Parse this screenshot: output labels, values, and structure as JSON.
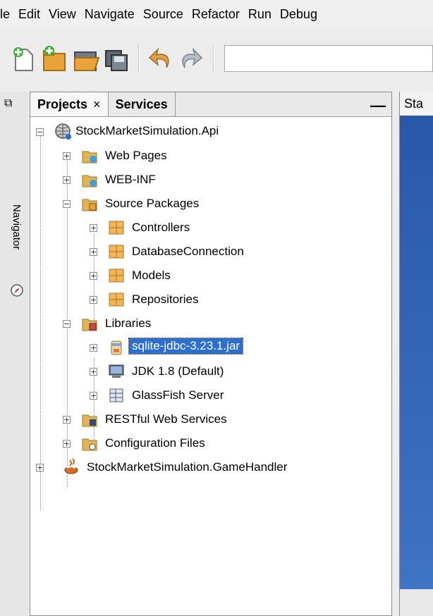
{
  "menu": [
    "File",
    "Edit",
    "View",
    "Navigate",
    "Source",
    "Refactor",
    "Run",
    "Debug"
  ],
  "menu_visible": [
    "ile",
    "Edit",
    "View",
    "Navigate",
    "Source",
    "Refactor",
    "Run",
    "Debug"
  ],
  "toolbar": {
    "icons": [
      "new-file-icon",
      "new-project-icon",
      "open-project-icon",
      "save-all-icon",
      "undo-icon",
      "redo-icon"
    ]
  },
  "navigator": {
    "label": "Navigator"
  },
  "panel": {
    "tabs": [
      {
        "label": "Projects",
        "close": "×",
        "active": true
      },
      {
        "label": "Services",
        "active": false
      }
    ],
    "minimize": "—"
  },
  "tree": {
    "root1": "StockMarketSimulation.Api",
    "web_pages": "Web Pages",
    "web_inf": "WEB-INF",
    "source_packages": "Source Packages",
    "controllers": "Controllers",
    "database_connection": "DatabaseConnection",
    "models": "Models",
    "repositories": "Repositories",
    "libraries": "Libraries",
    "sqlite": "sqlite-jdbc-3.23.1.jar",
    "jdk": "JDK 1.8 (Default)",
    "glassfish": "GlassFish Server",
    "restful": "RESTful Web Services",
    "config": "Configuration Files",
    "root2": "StockMarketSimulation.GameHandler"
  },
  "editor": {
    "tab": "Sta"
  },
  "colors": {
    "selection": "#2c6fce",
    "package": "#e8a33a",
    "folder": "#d9a13b"
  }
}
